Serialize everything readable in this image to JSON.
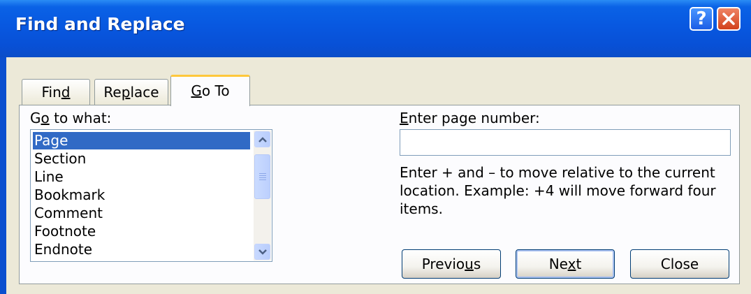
{
  "window": {
    "title": "Find and Replace",
    "help_glyph": "?",
    "colors": {
      "titlebar": "#0858e0",
      "close_button": "#d2411b",
      "selection": "#316ac5",
      "active_tab_accent": "#ffc83c"
    }
  },
  "tabs": [
    {
      "pre": "Fin",
      "u": "d",
      "post": "",
      "active": false
    },
    {
      "pre": "Re",
      "u": "p",
      "post": "lace",
      "active": false
    },
    {
      "pre": "",
      "u": "G",
      "post": "o To",
      "active": true
    }
  ],
  "goto": {
    "what_label": {
      "pre": "G",
      "u": "o",
      "post": " to what:"
    },
    "items": [
      "Page",
      "Section",
      "Line",
      "Bookmark",
      "Comment",
      "Footnote",
      "Endnote"
    ],
    "selected_item": "Page",
    "page_label": {
      "pre": "",
      "u": "E",
      "post": "nter page number:"
    },
    "page_value": "",
    "help_text": "Enter + and – to move relative to the current location. Example: +4 will move forward four items."
  },
  "buttons": {
    "previous": {
      "pre": "Previo",
      "u": "u",
      "post": "s"
    },
    "next": {
      "pre": "Ne",
      "u": "x",
      "post": "t"
    },
    "close": {
      "label": "Close"
    }
  }
}
